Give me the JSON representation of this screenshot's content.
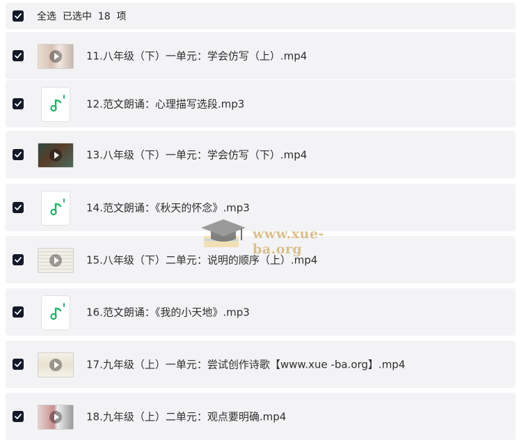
{
  "header": {
    "select_all_text": "全选  已选中  18  项"
  },
  "files": [
    {
      "name": "11.八年级（下）一单元：学会仿写（上）.mp4",
      "type": "video"
    },
    {
      "name": "12.范文朗诵：心理描写选段.mp3",
      "type": "audio"
    },
    {
      "name": "13.八年级（下）一单元：学会仿写（下）.mp4",
      "type": "video"
    },
    {
      "name": "14.范文朗诵：《秋天的怀念》.mp3",
      "type": "audio"
    },
    {
      "name": "15.八年级（下）二单元：说明的顺序（上）.mp4",
      "type": "video"
    },
    {
      "name": "16.范文朗诵：《我的小天地》.mp3",
      "type": "audio"
    },
    {
      "name": "17.九年级（上）一单元：尝试创作诗歌【www.xue -ba.org】.mp4",
      "type": "video"
    },
    {
      "name": "18.九年级（上）二单元：观点要明确.mp4",
      "type": "video"
    }
  ],
  "watermark": "www.xue-ba.org",
  "colors": {
    "checkbox": "#141929",
    "row_bg": "#f3f3f5",
    "audio_icon": "#22b36b"
  }
}
